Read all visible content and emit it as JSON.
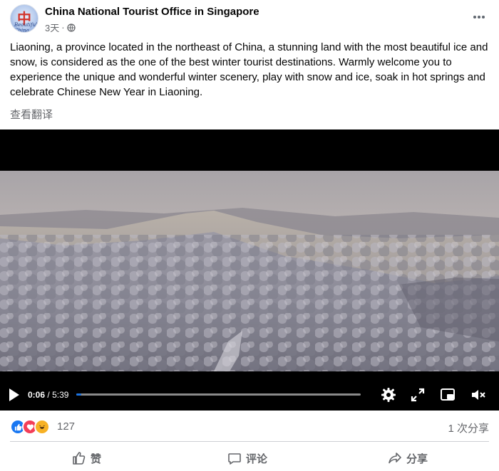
{
  "post": {
    "page_name": "China National Tourist Office in Singapore",
    "timestamp": "3天",
    "separator": "·",
    "audience_icon": "globe-icon",
    "avatar_text_main": "中国",
    "avatar_text_script": "Beautiful China",
    "text": "Liaoning, a province located in the northeast of China, a stunning  land with the most beautiful ice and snow, is considered as the one of the best winter tourist destinations. Warmly welcome you to experience the unique and wonderful winter scenery, play with snow and ice, soak in hot springs and celebrate Chinese New Year in Liaoning.",
    "see_translation": "查看翻译"
  },
  "video": {
    "current_time": "0:06",
    "divider": "/",
    "duration": "5:39",
    "progress": 0.018,
    "icons": [
      "play-icon",
      "settings-icon",
      "fullscreen-icon",
      "picture-in-picture-icon",
      "mute-icon"
    ]
  },
  "engagement": {
    "reaction_icons": [
      "like-icon",
      "love-icon",
      "haha-icon"
    ],
    "reaction_count": "127",
    "views": "1 次分享"
  },
  "actions": {
    "like_label": "赞",
    "comment_label": "评论",
    "share_label": "分享"
  },
  "colors": {
    "accent": "#1b74e4",
    "secondary_text": "#65676b",
    "like_blue": "#1877f2",
    "love_red": "#f33e58",
    "haha_yellow": "#f7b125"
  }
}
